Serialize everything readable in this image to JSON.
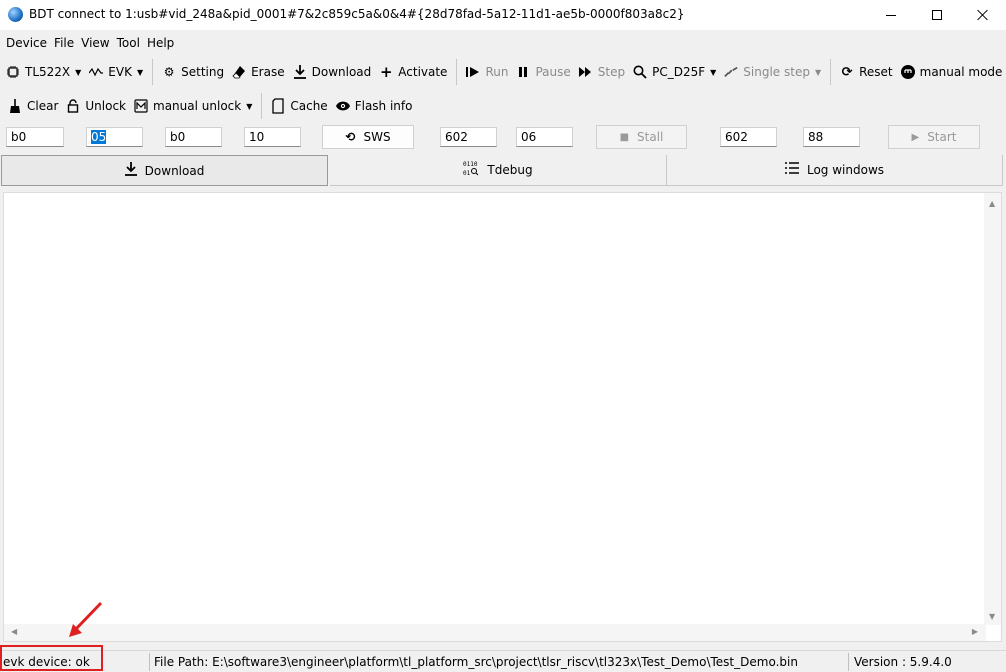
{
  "window": {
    "title": "BDT connect to 1:usb#vid_248a&pid_0001#7&2c859c5a&0&4#{28d78fad-5a12-11d1-ae5b-0000f803a8c2}"
  },
  "menu": [
    "Device",
    "File",
    "View",
    "Tool",
    "Help"
  ],
  "toolbar1": {
    "chip": "TL522X",
    "board": "EVK",
    "setting": "Setting",
    "erase": "Erase",
    "download": "Download",
    "activate": "Activate",
    "run": "Run",
    "pause": "Pause",
    "step": "Step",
    "pc": "PC_D25F",
    "single_step": "Single step",
    "reset": "Reset",
    "mode": "manual mode"
  },
  "toolbar2": {
    "clear": "Clear",
    "unlock": "Unlock",
    "manual_unlock": "manual unlock",
    "cache": "Cache",
    "flash_info": "Flash info"
  },
  "fields": {
    "f1": "b0",
    "f2": "05",
    "f3": "b0",
    "f4": "10",
    "sws": "SWS",
    "f5": "602",
    "f6": "06",
    "stall": "Stall",
    "f7": "602",
    "f8": "88",
    "start": "Start"
  },
  "tabs": [
    "Download",
    "Tdebug",
    "Log windows"
  ],
  "status": {
    "device": "evk device: ok",
    "file_path": "File Path:  E:\\software3\\engineer\\platform\\tl_platform_src\\project\\tlsr_riscv\\tl323x\\Test_Demo\\Test_Demo.bin",
    "version": "Version : 5.9.4.0"
  },
  "colors": {
    "highlight": "#e02020",
    "selection": "#0078d7"
  }
}
